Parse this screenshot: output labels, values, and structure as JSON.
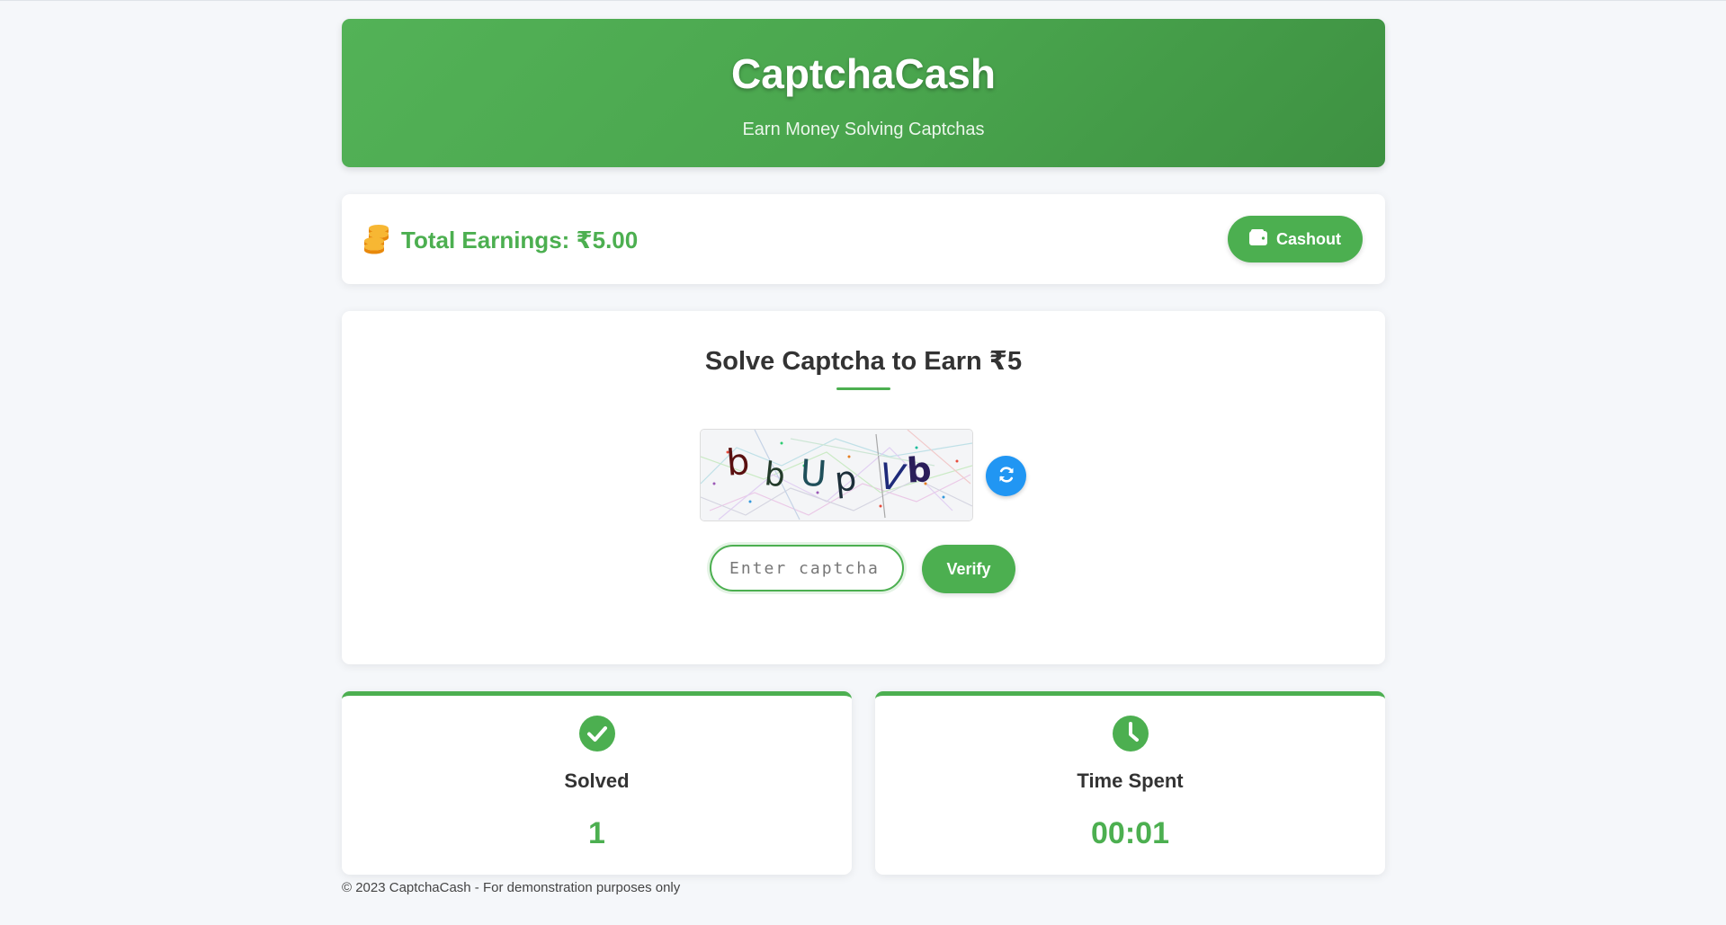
{
  "header": {
    "title": "CaptchaCash",
    "subtitle": "Earn Money Solving Captchas"
  },
  "earnings": {
    "icon": "coins-icon",
    "label": "Total Earnings: ₹5.00",
    "cashout_label": "Cashout",
    "cashout_icon": "wallet-icon"
  },
  "solve": {
    "title": "Solve Captcha to Earn ₹5",
    "captcha_text": "bbUpVb",
    "refresh_icon": "refresh-icon",
    "input_placeholder": "Enter captcha text",
    "input_value": "",
    "verify_label": "Verify"
  },
  "stats": [
    {
      "icon": "check-circle-icon",
      "label": "Solved",
      "value": "1"
    },
    {
      "icon": "clock-icon",
      "label": "Time Spent",
      "value": "00:01"
    }
  ],
  "footer": {
    "text": "© 2023 CaptchaCash - For demonstration purposes only"
  },
  "colors": {
    "primary": "#4caf50",
    "accent_blue": "#2196f3",
    "coin": "#f39c12",
    "background": "#f5f7fa"
  }
}
